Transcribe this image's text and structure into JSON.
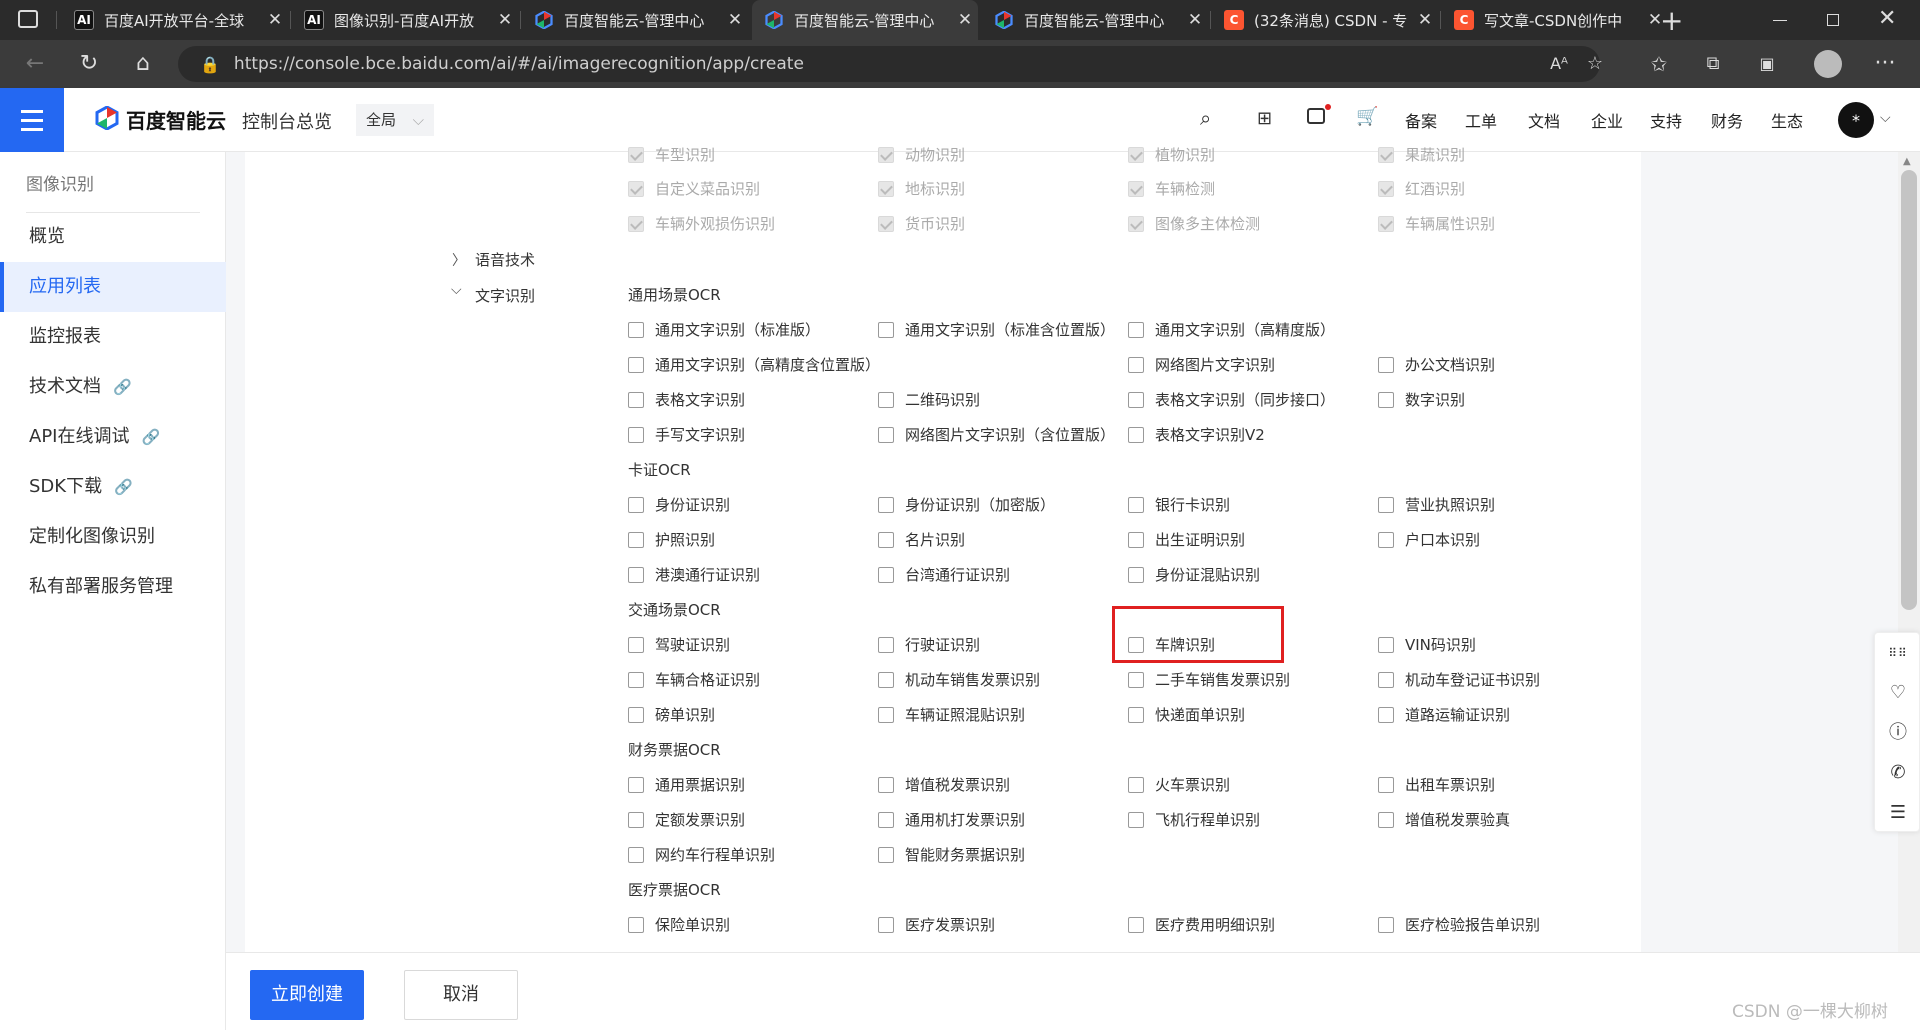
{
  "browser": {
    "tabs": [
      {
        "title": "百度AI开放平台-全球",
        "icon": "AI"
      },
      {
        "title": "图像识别-百度AI开放",
        "icon": "AI"
      },
      {
        "title": "百度智能云-管理中心",
        "icon": "baidu-cloud"
      },
      {
        "title": "百度智能云-管理中心",
        "icon": "baidu-cloud"
      },
      {
        "title": "百度智能云-管理中心",
        "icon": "baidu-cloud"
      },
      {
        "title": "(32条消息) CSDN - 专",
        "icon": "C"
      },
      {
        "title": "写文章-CSDN创作中",
        "icon": "C"
      }
    ],
    "url": "https://console.bce.baidu.com/ai/#/ai/imagerecognition/app/create"
  },
  "header": {
    "brand": "百度智能云",
    "console": "控制台总览",
    "region": "全局",
    "nav": [
      "备案",
      "工单",
      "文档",
      "企业",
      "支持",
      "财务",
      "生态"
    ],
    "avatar": "*"
  },
  "sidebar": {
    "title": "图像识别",
    "items": [
      {
        "label": "概览",
        "link": false
      },
      {
        "label": "应用列表",
        "link": false,
        "active": true
      },
      {
        "label": "监控报表",
        "link": false
      },
      {
        "label": "技术文档",
        "link": true
      },
      {
        "label": "API在线调试",
        "link": true
      },
      {
        "label": "SDK下载",
        "link": true
      },
      {
        "label": "定制化图像识别",
        "link": false
      },
      {
        "label": "私有部署服务管理",
        "link": false
      }
    ]
  },
  "tree": {
    "speech": "语音技术",
    "ocr": "文字识别"
  },
  "disabled_items": [
    [
      "车型识别",
      "动物识别",
      "植物识别",
      "果蔬识别"
    ],
    [
      "自定义菜品识别",
      "地标识别",
      "车辆检测",
      "红酒识别"
    ],
    [
      "车辆外观损伤识别",
      "货币识别",
      "图像多主体检测",
      "车辆属性识别"
    ]
  ],
  "groups": [
    {
      "title": "通用场景OCR",
      "rows": [
        [
          "通用文字识别（标准版）",
          "通用文字识别（标准含位置版）",
          "通用文字识别（高精度版）",
          ""
        ],
        [
          "通用文字识别（高精度含位置版）",
          "",
          "网络图片文字识别",
          "办公文档识别"
        ],
        [
          "表格文字识别",
          "二维码识别",
          "表格文字识别（同步接口）",
          "数字识别"
        ],
        [
          "手写文字识别",
          "网络图片文字识别（含位置版）",
          "表格文字识别V2",
          ""
        ]
      ]
    },
    {
      "title": "卡证OCR",
      "rows": [
        [
          "身份证识别",
          "身份证识别（加密版）",
          "银行卡识别",
          "营业执照识别"
        ],
        [
          "护照识别",
          "名片识别",
          "出生证明识别",
          "户口本识别"
        ],
        [
          "港澳通行证识别",
          "台湾通行证识别",
          "身份证混贴识别",
          ""
        ]
      ]
    },
    {
      "title": "交通场景OCR",
      "rows": [
        [
          "驾驶证识别",
          "行驶证识别",
          "车牌识别",
          "VIN码识别"
        ],
        [
          "车辆合格证识别",
          "机动车销售发票识别",
          "二手车销售发票识别",
          "机动车登记证书识别"
        ],
        [
          "磅单识别",
          "车辆证照混贴识别",
          "快递面单识别",
          "道路运输证识别"
        ]
      ]
    },
    {
      "title": "财务票据OCR",
      "rows": [
        [
          "通用票据识别",
          "增值税发票识别",
          "火车票识别",
          "出租车票识别"
        ],
        [
          "定额发票识别",
          "通用机打发票识别",
          "飞机行程单识别",
          "增值税发票验真"
        ],
        [
          "网约车行程单识别",
          "智能财务票据识别",
          "",
          ""
        ]
      ]
    },
    {
      "title": "医疗票据OCR",
      "rows": [
        [
          "保险单识别",
          "医疗发票识别",
          "医疗费用明细识别",
          "医疗检验报告单识别"
        ]
      ]
    }
  ],
  "footer": {
    "create": "立即创建",
    "cancel": "取消",
    "watermark": "CSDN @一棵大柳树"
  },
  "colors": {
    "accent": "#2468f2",
    "highlight": "#e02020"
  }
}
